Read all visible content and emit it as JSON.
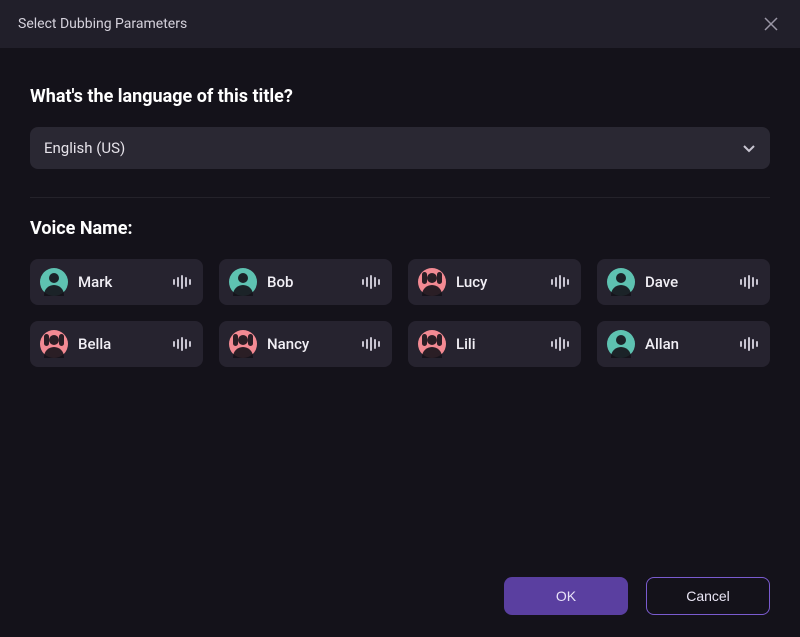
{
  "window": {
    "title": "Select Dubbing Parameters"
  },
  "language": {
    "prompt": "What's the language of this title?",
    "selected": "English (US)"
  },
  "voices": {
    "section_label": "Voice Name:",
    "items": [
      {
        "name": "Mark",
        "avatar_color": "teal"
      },
      {
        "name": "Bob",
        "avatar_color": "teal"
      },
      {
        "name": "Lucy",
        "avatar_color": "pink"
      },
      {
        "name": "Dave",
        "avatar_color": "teal"
      },
      {
        "name": "Bella",
        "avatar_color": "pink"
      },
      {
        "name": "Nancy",
        "avatar_color": "pink"
      },
      {
        "name": "Lili",
        "avatar_color": "pink"
      },
      {
        "name": "Allan",
        "avatar_color": "teal"
      }
    ]
  },
  "buttons": {
    "ok": "OK",
    "cancel": "Cancel"
  }
}
